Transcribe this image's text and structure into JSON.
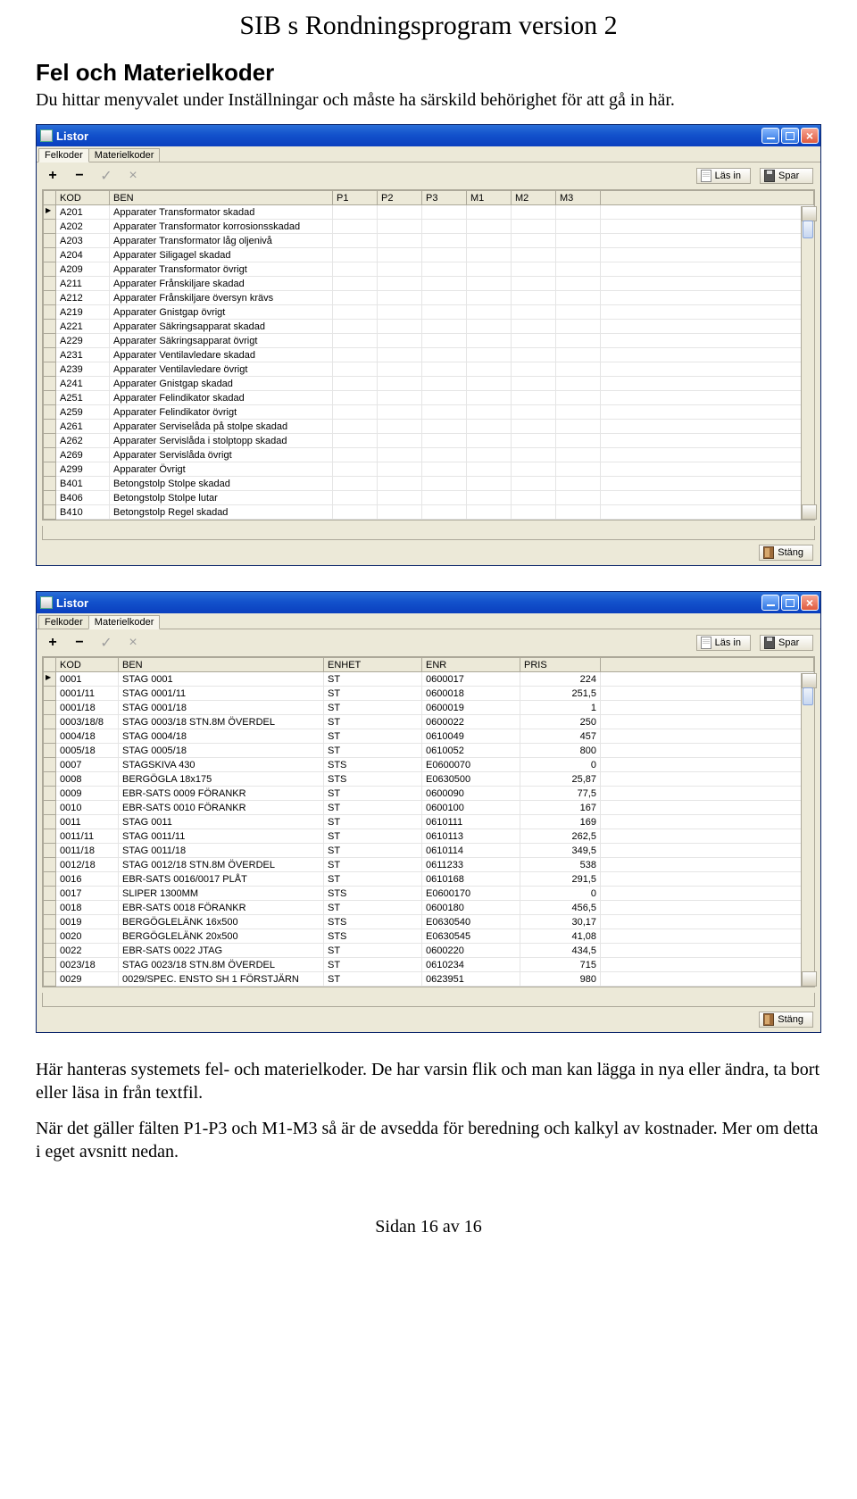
{
  "doc": {
    "title": "SIB s Rondningsprogram version 2",
    "section_heading": "Fel och Materielkoder",
    "intro": "Du hittar menyvalet under Inställningar och måste ha särskild behörighet för att gå in här.",
    "after_windows": "Här hanteras systemets fel- och materielkoder. De har varsin flik och man kan lägga in nya eller ändra, ta bort eller läsa in från textfil.",
    "after_windows2": "När det gäller fälten P1-P3 och M1-M3 så är de avsedda för beredning och kalkyl av kostnader. Mer om detta i eget avsnitt nedan.",
    "footer": "Sidan 16 av 16"
  },
  "window1": {
    "title": "Listor",
    "tabs": [
      "Felkoder",
      "Materielkoder"
    ],
    "active_tab": 0,
    "buttons": {
      "lasin": "Läs in",
      "spar": "Spar",
      "stang": "Stäng"
    },
    "columns": [
      "KOD",
      "BEN",
      "P1",
      "P2",
      "P3",
      "M1",
      "M2",
      "M3"
    ],
    "rows": [
      {
        "KOD": "A201",
        "BEN": "Apparater Transformator skadad"
      },
      {
        "KOD": "A202",
        "BEN": "Apparater Transformator korrosionsskadad"
      },
      {
        "KOD": "A203",
        "BEN": "Apparater Transformator låg oljenivå"
      },
      {
        "KOD": "A204",
        "BEN": "Apparater Siligagel skadad"
      },
      {
        "KOD": "A209",
        "BEN": "Apparater Transformator övrigt"
      },
      {
        "KOD": "A211",
        "BEN": "Apparater Frånskiljare skadad"
      },
      {
        "KOD": "A212",
        "BEN": "Apparater Frånskiljare översyn krävs"
      },
      {
        "KOD": "A219",
        "BEN": "Apparater Gnistgap övrigt"
      },
      {
        "KOD": "A221",
        "BEN": "Apparater Säkringsapparat skadad"
      },
      {
        "KOD": "A229",
        "BEN": "Apparater Säkringsapparat övrigt"
      },
      {
        "KOD": "A231",
        "BEN": "Apparater Ventilavledare skadad"
      },
      {
        "KOD": "A239",
        "BEN": "Apparater Ventilavledare övrigt"
      },
      {
        "KOD": "A241",
        "BEN": "Apparater Gnistgap skadad"
      },
      {
        "KOD": "A251",
        "BEN": "Apparater Felindikator skadad"
      },
      {
        "KOD": "A259",
        "BEN": "Apparater Felindikator övrigt"
      },
      {
        "KOD": "A261",
        "BEN": "Apparater Serviselåda på stolpe skadad"
      },
      {
        "KOD": "A262",
        "BEN": "Apparater Servislåda i stolptopp skadad"
      },
      {
        "KOD": "A269",
        "BEN": "Apparater Servislåda övrigt"
      },
      {
        "KOD": "A299",
        "BEN": "Apparater Övrigt"
      },
      {
        "KOD": "B401",
        "BEN": "Betongstolp Stolpe skadad"
      },
      {
        "KOD": "B406",
        "BEN": "Betongstolp Stolpe lutar"
      },
      {
        "KOD": "B410",
        "BEN": "Betongstolp Regel skadad"
      }
    ]
  },
  "window2": {
    "title": "Listor",
    "tabs": [
      "Felkoder",
      "Materielkoder"
    ],
    "active_tab": 1,
    "buttons": {
      "lasin": "Läs in",
      "spar": "Spar",
      "stang": "Stäng"
    },
    "columns": [
      "KOD",
      "BEN",
      "ENHET",
      "ENR",
      "PRIS"
    ],
    "rows": [
      {
        "KOD": "0001",
        "BEN": "STAG 0001",
        "ENHET": "ST",
        "ENR": "0600017",
        "PRIS": "224"
      },
      {
        "KOD": "0001/11",
        "BEN": "STAG 0001/11",
        "ENHET": "ST",
        "ENR": "0600018",
        "PRIS": "251,5"
      },
      {
        "KOD": "0001/18",
        "BEN": "STAG 0001/18",
        "ENHET": "ST",
        "ENR": "0600019",
        "PRIS": "1"
      },
      {
        "KOD": "0003/18/8",
        "BEN": "STAG 0003/18 STN.8M ÖVERDEL",
        "ENHET": "ST",
        "ENR": "0600022",
        "PRIS": "250"
      },
      {
        "KOD": "0004/18",
        "BEN": "STAG 0004/18",
        "ENHET": "ST",
        "ENR": "0610049",
        "PRIS": "457"
      },
      {
        "KOD": "0005/18",
        "BEN": "STAG 0005/18",
        "ENHET": "ST",
        "ENR": "0610052",
        "PRIS": "800"
      },
      {
        "KOD": "0007",
        "BEN": "STAGSKIVA 430",
        "ENHET": "STS",
        "ENR": "E0600070",
        "PRIS": "0"
      },
      {
        "KOD": "0008",
        "BEN": "BERGÖGLA 18x175",
        "ENHET": "STS",
        "ENR": "E0630500",
        "PRIS": "25,87"
      },
      {
        "KOD": "0009",
        "BEN": "EBR-SATS 0009 FÖRANKR",
        "ENHET": "ST",
        "ENR": "0600090",
        "PRIS": "77,5"
      },
      {
        "KOD": "0010",
        "BEN": "EBR-SATS 0010 FÖRANKR",
        "ENHET": "ST",
        "ENR": "0600100",
        "PRIS": "167"
      },
      {
        "KOD": "0011",
        "BEN": "STAG 0011",
        "ENHET": "ST",
        "ENR": "0610111",
        "PRIS": "169"
      },
      {
        "KOD": "0011/11",
        "BEN": "STAG 0011/11",
        "ENHET": "ST",
        "ENR": "0610113",
        "PRIS": "262,5"
      },
      {
        "KOD": "0011/18",
        "BEN": "STAG 0011/18",
        "ENHET": "ST",
        "ENR": "0610114",
        "PRIS": "349,5"
      },
      {
        "KOD": "0012/18",
        "BEN": "STAG 0012/18 STN.8M ÖVERDEL",
        "ENHET": "ST",
        "ENR": "0611233",
        "PRIS": "538"
      },
      {
        "KOD": "0016",
        "BEN": "EBR-SATS 0016/0017 PLÅT",
        "ENHET": "ST",
        "ENR": "0610168",
        "PRIS": "291,5"
      },
      {
        "KOD": "0017",
        "BEN": "SLIPER 1300MM",
        "ENHET": "STS",
        "ENR": "E0600170",
        "PRIS": "0"
      },
      {
        "KOD": "0018",
        "BEN": "EBR-SATS 0018 FÖRANKR",
        "ENHET": "ST",
        "ENR": "0600180",
        "PRIS": "456,5"
      },
      {
        "KOD": "0019",
        "BEN": "BERGÖGLELÄNK 16x500",
        "ENHET": "STS",
        "ENR": "E0630540",
        "PRIS": "30,17"
      },
      {
        "KOD": "0020",
        "BEN": "BERGÖGLELÄNK 20x500",
        "ENHET": "STS",
        "ENR": "E0630545",
        "PRIS": "41,08"
      },
      {
        "KOD": "0022",
        "BEN": "EBR-SATS 0022 JTAG",
        "ENHET": "ST",
        "ENR": "0600220",
        "PRIS": "434,5"
      },
      {
        "KOD": "0023/18",
        "BEN": "STAG 0023/18 STN.8M ÖVERDEL",
        "ENHET": "ST",
        "ENR": "0610234",
        "PRIS": "715"
      },
      {
        "KOD": "0029",
        "BEN": "0029/SPEC. ENSTO SH 1 FÖRSTJÄRN",
        "ENHET": "ST",
        "ENR": "0623951",
        "PRIS": "980"
      }
    ]
  }
}
